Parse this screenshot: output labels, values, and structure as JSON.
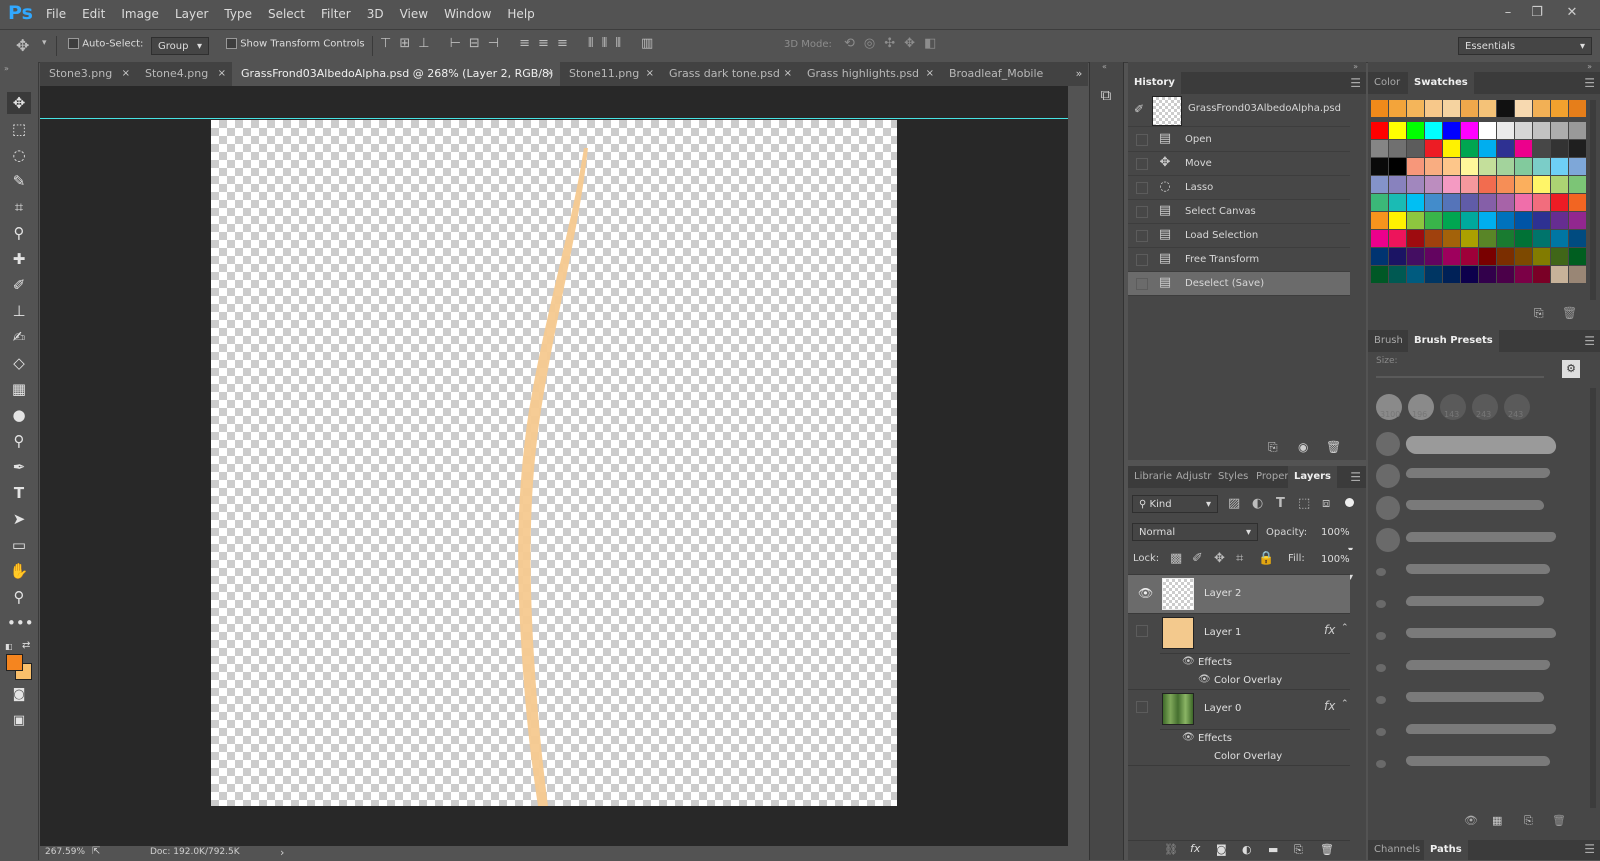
{
  "app": {
    "logo": "Ps"
  },
  "menu": [
    "File",
    "Edit",
    "Image",
    "Layer",
    "Type",
    "Select",
    "Filter",
    "3D",
    "View",
    "Window",
    "Help"
  ],
  "window_controls": {
    "minimize": "–",
    "restore": "❐",
    "close": "✕"
  },
  "options": {
    "auto_select_label": "Auto-Select:",
    "auto_select_value": "Group",
    "transform_label": "Show Transform Controls",
    "mode_3d_label": "3D Mode:",
    "workspace": "Essentials"
  },
  "tabs": [
    {
      "label": "Stone3.png",
      "close": "×"
    },
    {
      "label": "Stone4.png",
      "close": "×"
    },
    {
      "label": "GrassFrond03AlbedoAlpha.psd @ 268% (Layer 2, RGB/8)",
      "close": "×",
      "active": true
    },
    {
      "label": "Stone11.png",
      "close": "×"
    },
    {
      "label": "Grass dark tone.psd",
      "close": "×"
    },
    {
      "label": "Grass highlights.psd",
      "close": "×"
    },
    {
      "label": "Broadleaf_Mobile",
      "close": ""
    }
  ],
  "tabs_overflow": "»",
  "status": {
    "zoom": "267.59%",
    "doc": "Doc: 192.0K/792.5K",
    "arrow": "›"
  },
  "history": {
    "tab": "History",
    "snapshot": "GrassFrond03AlbedoAlpha.psd",
    "steps": [
      {
        "label": "Open",
        "icon": "doc-icon"
      },
      {
        "label": "Move",
        "icon": "move-icon"
      },
      {
        "label": "Lasso",
        "icon": "lasso-icon"
      },
      {
        "label": "Select Canvas",
        "icon": "doc-icon"
      },
      {
        "label": "Load Selection",
        "icon": "doc-icon"
      },
      {
        "label": "Free Transform",
        "icon": "doc-icon"
      },
      {
        "label": "Deselect (Save)",
        "icon": "doc-icon",
        "selected": true
      }
    ]
  },
  "layers_panel": {
    "tabs": [
      "Librarie",
      "Adjustr",
      "Styles",
      "Proper",
      "Layers"
    ],
    "filter": "Kind",
    "blend_mode": "Normal",
    "opacity_label": "Opacity:",
    "opacity_value": "100%",
    "lock_label": "Lock:",
    "fill_label": "Fill:",
    "fill_value": "100%",
    "layers": [
      {
        "name": "Layer 2",
        "visible": true,
        "selected": true
      },
      {
        "name": "Layer 1",
        "visible": false,
        "fx": "fx",
        "effects_label": "Effects",
        "effect": "Color Overlay"
      },
      {
        "name": "Layer 0",
        "visible": false,
        "fx": "fx",
        "effects_label": "Effects",
        "effect": "Color Overlay"
      }
    ]
  },
  "color_panel": {
    "tabs": [
      "Color",
      "Swatches"
    ]
  },
  "brush_panel": {
    "tabs": [
      "Brush",
      "Brush Presets"
    ],
    "size_label": "Size:",
    "preset_sizes": [
      "3100",
      "196",
      "143",
      "243",
      "243"
    ]
  },
  "bottom_panel": {
    "tabs": [
      "Channels",
      "Paths"
    ]
  },
  "colors": {
    "foreground": "#f5851f",
    "background": "#f9bf6b",
    "frond": "#f6c98f",
    "guide": "#47e3e3"
  },
  "swatch_rows": [
    [
      "#f08a1a",
      "#f3a43a",
      "#f4b55a",
      "#f7c88a",
      "#f5d3a0",
      "#efa84b",
      "#f4c278",
      "#111111",
      "#f7d9b0",
      "#f2b055",
      "#f2a12e",
      "#e67e1a"
    ],
    [
      "#ff0000",
      "#ffff00",
      "#00ff00",
      "#00ffff",
      "#0000ff",
      "#ff00ff",
      "#ffffff",
      "#ebebeb",
      "#d6d6d6",
      "#c2c2c2",
      "#adadad",
      "#999999"
    ],
    [
      "#858585",
      "#707070",
      "#5c5c5c",
      "#ed1c24",
      "#fff200",
      "#00a651",
      "#00aeef",
      "#2e3192",
      "#ec008c",
      "#474747",
      "#333333",
      "#1f1f1f"
    ],
    [
      "#0a0a0a",
      "#000000",
      "#f7977a",
      "#f9ad81",
      "#fdc68a",
      "#fff79a",
      "#c4df9b",
      "#a3d39c",
      "#82ca9d",
      "#7bcdc8",
      "#6ecff6",
      "#7ea7d8"
    ],
    [
      "#8493ca",
      "#8882be",
      "#a187be",
      "#bc8dbf",
      "#f49ac2",
      "#f6989d",
      "#f26c4f",
      "#f68e56",
      "#fbaf5d",
      "#fff568",
      "#acd373",
      "#7cc576"
    ],
    [
      "#3bb878",
      "#1abbb4",
      "#00bff3",
      "#438ccb",
      "#5574b9",
      "#605ca8",
      "#855fa8",
      "#a763a8",
      "#f06eaa",
      "#f26d7d",
      "#ed1c24",
      "#f26522"
    ],
    [
      "#f7941d",
      "#fff200",
      "#8dc73f",
      "#39b54a",
      "#00a651",
      "#00a99d",
      "#00aeef",
      "#0072bc",
      "#0054a6",
      "#2e3192",
      "#662d91",
      "#92278f"
    ],
    [
      "#ec008c",
      "#ed145b",
      "#9e0b0f",
      "#a0410d",
      "#a3620a",
      "#aba000",
      "#598527",
      "#197b30",
      "#007236",
      "#00746b",
      "#0076a3",
      "#004b80"
    ],
    [
      "#003471",
      "#1b1464",
      "#440e62",
      "#630460",
      "#9e005d",
      "#9e0039",
      "#790000",
      "#7b2e00",
      "#7d4900",
      "#827b00",
      "#406618",
      "#005e20"
    ],
    [
      "#005826",
      "#005952",
      "#005b7f",
      "#003663",
      "#002157",
      "#0d004c",
      "#32004b",
      "#4b0049",
      "#7b0046",
      "#7a0026",
      "#c7b299",
      "#998675"
    ]
  ]
}
